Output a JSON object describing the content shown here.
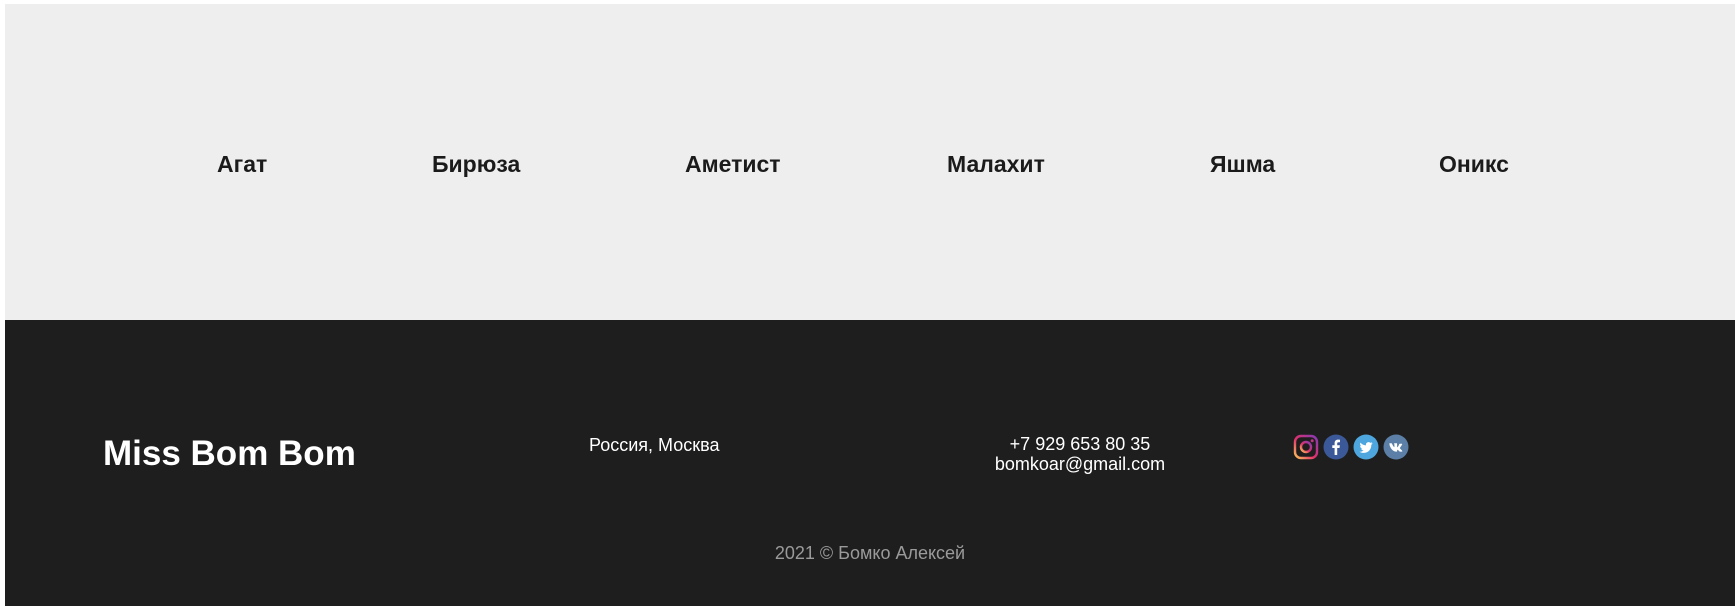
{
  "stones": {
    "items": [
      {
        "label": "Агат"
      },
      {
        "label": "Бирюза"
      },
      {
        "label": "Аметист"
      },
      {
        "label": "Малахит"
      },
      {
        "label": "Яшма"
      },
      {
        "label": "Оникс"
      }
    ]
  },
  "footer": {
    "brand": "Miss Bom Bom",
    "location": "Россия, Москва",
    "phone": "+7 929 653 80 35",
    "email": "bomkoar@gmail.com",
    "socials": [
      {
        "icon": "instagram-icon"
      },
      {
        "icon": "facebook-icon"
      },
      {
        "icon": "twitter-icon"
      },
      {
        "icon": "vk-icon"
      }
    ],
    "copyright": "2021 © Бомко Алексей"
  },
  "colors": {
    "top_background": "#eeeeee",
    "footer_background": "#1e1e1e",
    "nav_text": "#1b1b1b",
    "footer_text": "#ffffff",
    "copyright_text": "#9a9a9a"
  }
}
